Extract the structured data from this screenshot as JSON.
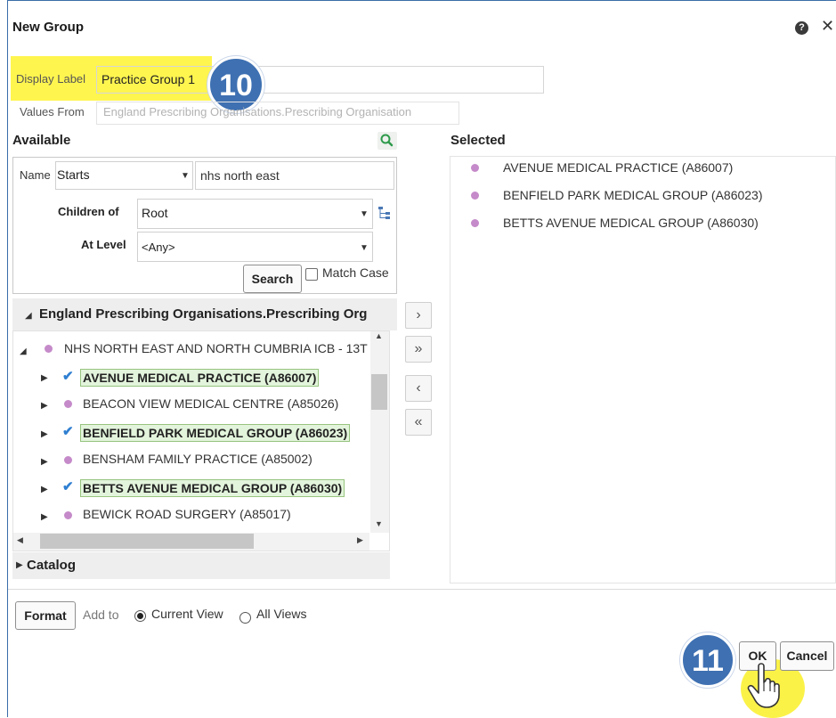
{
  "dialog": {
    "title": "New Group",
    "help_icon": "help-icon",
    "close_icon": "close-icon"
  },
  "display_label": {
    "label": "Display Label",
    "value": "Practice Group 1"
  },
  "values_from": {
    "label": "Values From",
    "value": "England Prescribing Organisations.Prescribing Organisation"
  },
  "steps": {
    "step_a": "10",
    "step_b": "11"
  },
  "available": {
    "heading": "Available",
    "search_icon": "magnifier-icon",
    "name_label": "Name",
    "match_type": "Starts",
    "name_value": "nhs north east",
    "children_label": "Children of",
    "children_value": "Root",
    "level_label": "At Level",
    "level_value": "<Any>",
    "search_button": "Search",
    "match_case_label": "Match Case",
    "match_case_checked": false,
    "tree_header": "England Prescribing Organisations.Prescribing Org",
    "tree_root": "NHS NORTH EAST AND NORTH CUMBRIA ICB - 13T",
    "tree_items": [
      {
        "label": "AVENUE MEDICAL PRACTICE (A86007)",
        "selected": true
      },
      {
        "label": "BEACON VIEW MEDICAL CENTRE (A85026)",
        "selected": false
      },
      {
        "label": "BENFIELD PARK MEDICAL GROUP (A86023)",
        "selected": true
      },
      {
        "label": "BENSHAM FAMILY PRACTICE (A85002)",
        "selected": false
      },
      {
        "label": "BETTS AVENUE MEDICAL GROUP (A86030)",
        "selected": true
      },
      {
        "label": "BEWICK ROAD SURGERY (A85017)",
        "selected": false
      }
    ],
    "catalog_label": "Catalog"
  },
  "move_buttons": {
    "move_right": "›",
    "move_all_right": "»",
    "move_left": "‹",
    "move_all_left": "«"
  },
  "selected": {
    "heading": "Selected",
    "items": [
      "AVENUE MEDICAL PRACTICE (A86007)",
      "BENFIELD PARK MEDICAL GROUP (A86023)",
      "BETTS AVENUE MEDICAL GROUP (A86030)"
    ]
  },
  "footer": {
    "format_button": "Format",
    "add_to_label": "Add to",
    "current_view_label": "Current View",
    "all_views_label": "All Views",
    "current_view_selected": true,
    "ok_button": "OK",
    "cancel_button": "Cancel"
  },
  "colors": {
    "highlight": "#fff54f",
    "badge": "#3e70b2",
    "member_dot": "#c58ac9",
    "check": "#2f7fd1",
    "selected_fill": "#e3f4dc"
  }
}
